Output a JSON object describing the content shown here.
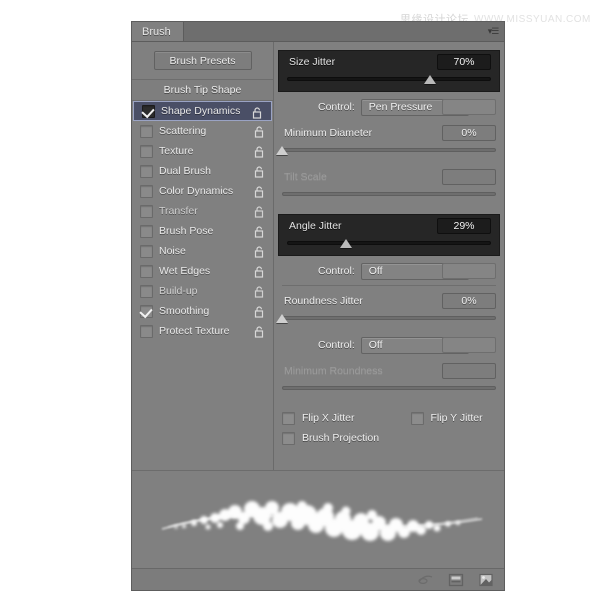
{
  "watermark": {
    "cn": "思缘设计论坛",
    "en": "WWW.MISSYUAN.COM"
  },
  "panel": {
    "tab_label": "Brush",
    "menu_icon": "panel-menu-icon"
  },
  "sidebar": {
    "presets_button": "Brush Presets",
    "tip_shape_label": "Brush Tip Shape",
    "items": [
      {
        "label": "Shape Dynamics",
        "checked": true,
        "selected": true,
        "dim": false
      },
      {
        "label": "Scattering",
        "checked": false,
        "selected": false,
        "dim": false
      },
      {
        "label": "Texture",
        "checked": false,
        "selected": false,
        "dim": false
      },
      {
        "label": "Dual Brush",
        "checked": false,
        "selected": false,
        "dim": false
      },
      {
        "label": "Color Dynamics",
        "checked": false,
        "selected": false,
        "dim": false
      },
      {
        "label": "Transfer",
        "checked": false,
        "selected": false,
        "dim": true
      },
      {
        "label": "Brush Pose",
        "checked": false,
        "selected": false,
        "dim": false
      },
      {
        "label": "Noise",
        "checked": false,
        "selected": false,
        "dim": false
      },
      {
        "label": "Wet Edges",
        "checked": false,
        "selected": false,
        "dim": false
      },
      {
        "label": "Build-up",
        "checked": false,
        "selected": false,
        "dim": true
      },
      {
        "label": "Smoothing",
        "checked": true,
        "selected": false,
        "dim": false
      },
      {
        "label": "Protect Texture",
        "checked": false,
        "selected": false,
        "dim": false
      }
    ]
  },
  "options": {
    "size_jitter": {
      "label": "Size Jitter",
      "value": "70%",
      "slider_percent": 70,
      "highlighted": true
    },
    "size_control": {
      "label": "Control:",
      "value": "Pen Pressure"
    },
    "minimum_diameter": {
      "label": "Minimum Diameter",
      "value": "0%",
      "slider_percent": 0
    },
    "tilt_scale": {
      "label": "Tilt Scale",
      "value": "",
      "slider_percent": 0,
      "disabled": true
    },
    "angle_jitter": {
      "label": "Angle Jitter",
      "value": "29%",
      "slider_percent": 29,
      "highlighted": true
    },
    "angle_control": {
      "label": "Control:",
      "value": "Off"
    },
    "roundness_jitter": {
      "label": "Roundness Jitter",
      "value": "0%",
      "slider_percent": 0
    },
    "roundness_control": {
      "label": "Control:",
      "value": "Off"
    },
    "minimum_roundness": {
      "label": "Minimum Roundness",
      "value": "",
      "slider_percent": 0,
      "disabled": true
    },
    "flip_x_jitter": {
      "label": "Flip X Jitter",
      "checked": false
    },
    "flip_y_jitter": {
      "label": "Flip Y Jitter",
      "checked": false
    },
    "brush_projection": {
      "label": "Brush Projection",
      "checked": false
    }
  },
  "footer": {
    "icons": [
      "brush-stroke-icon",
      "new-preset-icon",
      "new-brush-icon"
    ]
  },
  "colors": {
    "panel_bg": "#808080",
    "highlight_block_bg": "#262626",
    "selection_blue": "#4a4f66",
    "text": "#ececec"
  }
}
